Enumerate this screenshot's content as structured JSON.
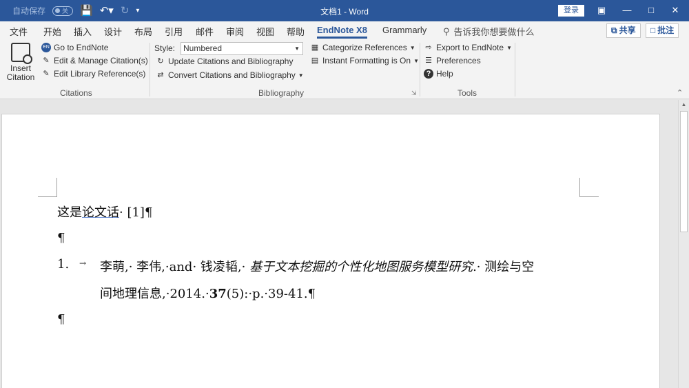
{
  "titlebar": {
    "autosave_label": "自动保存",
    "autosave_state": "关",
    "doc_title": "文档1 - Word",
    "login_label": "登录"
  },
  "tabs": [
    "文件",
    "开始",
    "插入",
    "设计",
    "布局",
    "引用",
    "邮件",
    "审阅",
    "视图",
    "帮助",
    "EndNote X8",
    "Grammarly"
  ],
  "active_tab": "EndNote X8",
  "search": {
    "text": "告诉我你想要做什么"
  },
  "share": {
    "share_label": "共享",
    "comment_label": "批注"
  },
  "ribbon": {
    "citations": {
      "insert_label_line1": "Insert",
      "insert_label_line2": "Citation",
      "go_to_endnote": "Go to EndNote",
      "edit_manage": "Edit & Manage Citation(s)",
      "edit_library": "Edit Library Reference(s)",
      "group_label": "Citations"
    },
    "bibliography": {
      "style_label": "Style:",
      "style_value": "Numbered",
      "update": "Update Citations and Bibliography",
      "convert": "Convert Citations and Bibliography",
      "categorize": "Categorize References",
      "instant_formatting": "Instant Formatting is On",
      "group_label": "Bibliography"
    },
    "tools": {
      "export": "Export to EndNote",
      "preferences": "Preferences",
      "help": "Help",
      "group_label": "Tools"
    }
  },
  "document": {
    "line1_plain": "这是",
    "line1_underlined": "论文话",
    "line1_rest": "· [1]¶",
    "pilcrow": "¶",
    "ref_number": "1.",
    "ref_tab": "→",
    "ref_authors": "李萌,· 李伟,·and· 钱凌韬,· ",
    "ref_title": "基于文本挖掘的个性化地图服务模型研究",
    "ref_journal_start": ".· 测绘与空",
    "ref_line2_start": "间地理信息,·2014.·",
    "ref_volume": "37",
    "ref_line2_end": "(5):·p.·39-41.¶"
  }
}
